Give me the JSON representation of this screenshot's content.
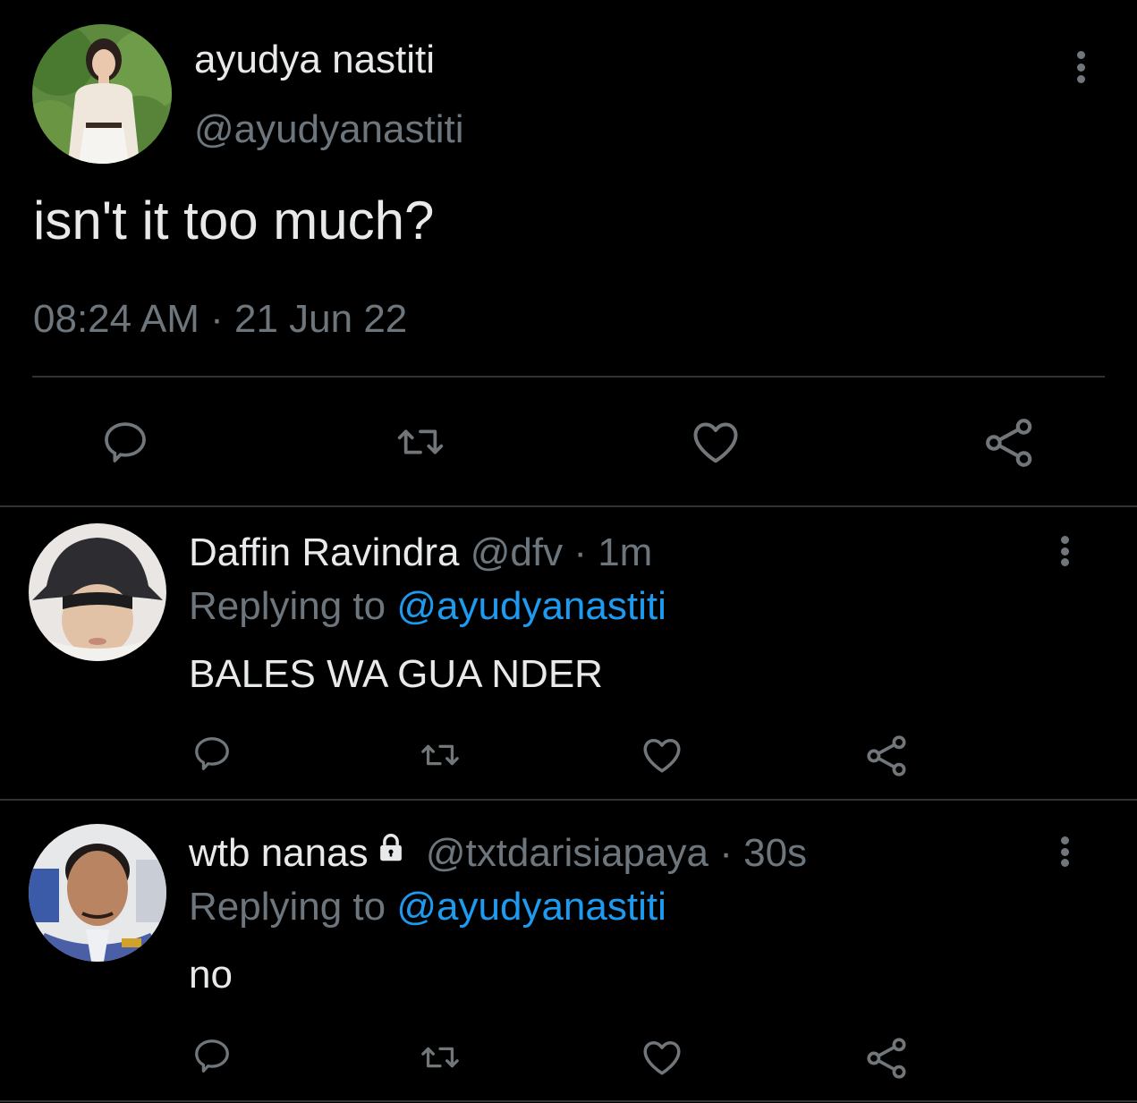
{
  "main_tweet": {
    "display_name": "ayudya nastiti",
    "handle": "@ayudyanastiti",
    "text": "isn't it too much?",
    "timestamp": "08:24 AM · 21 Jun 22",
    "actions": [
      "reply-icon",
      "retweet-icon",
      "like-icon",
      "share-icon"
    ]
  },
  "replies": [
    {
      "display_name": "Daffin Ravindra",
      "handle": "@dfv",
      "separator": "·",
      "age": "1m",
      "replying_prefix": "Replying to",
      "replying_to": "@ayudyanastiti",
      "text": "BALES WA GUA NDER",
      "protected": false
    },
    {
      "display_name": "wtb nanas",
      "handle": "@txtdarisiapaya",
      "separator": "·",
      "age": "30s",
      "replying_prefix": "Replying to",
      "replying_to": "@ayudyanastiti",
      "text": "no",
      "protected": true
    }
  ],
  "colors": {
    "background": "#000000",
    "primary_text": "#e7e9ea",
    "muted_text": "#6e767d",
    "link": "#1d9bf0",
    "divider": "#2f3336"
  }
}
